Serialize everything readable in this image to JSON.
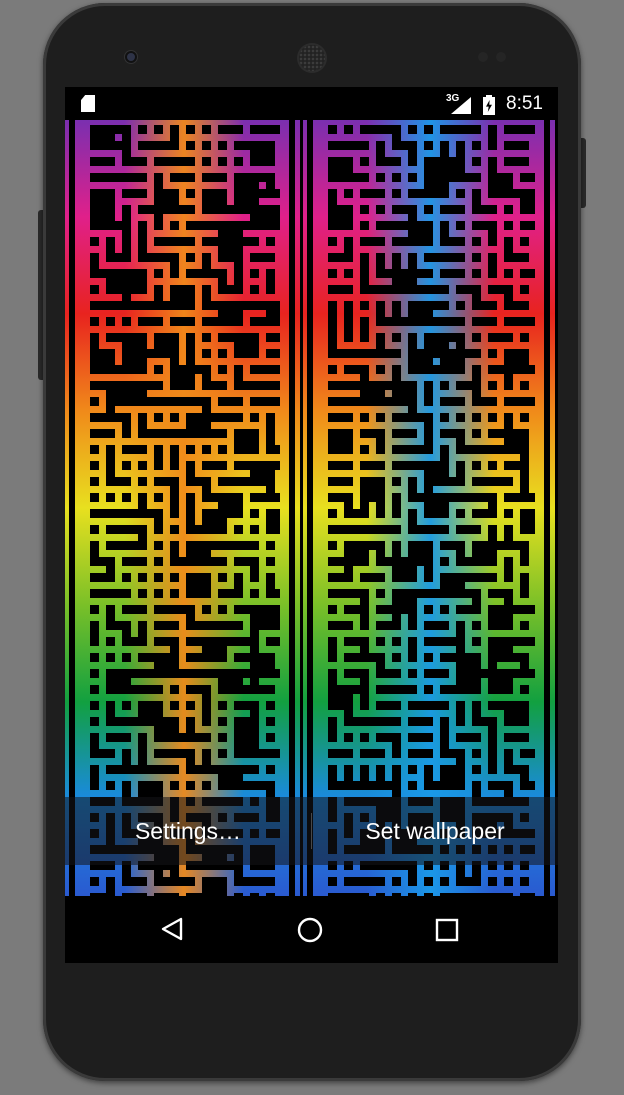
{
  "status_bar": {
    "network_type": "3G",
    "time": "8:51",
    "icons": [
      "sd-card-icon",
      "signal-icon",
      "battery-charging-icon"
    ]
  },
  "wallpaper_preview": {
    "description_icons": [
      "maze-pattern"
    ],
    "colors": {
      "left_panel_center": "#f08a1a",
      "right_panel_center": "#1a9ae8",
      "rainbow": [
        "#7a2fb0",
        "#e0208a",
        "#e8231f",
        "#f08a1a",
        "#e8e01f",
        "#7ac028",
        "#12a040",
        "#1a8ae0",
        "#2a5ad0"
      ]
    }
  },
  "actions": {
    "settings_label": "Settings…",
    "set_wallpaper_label": "Set wallpaper"
  },
  "navigation": {
    "back_icon": "back-triangle-icon",
    "home_icon": "home-circle-icon",
    "recents_icon": "recents-square-icon"
  }
}
